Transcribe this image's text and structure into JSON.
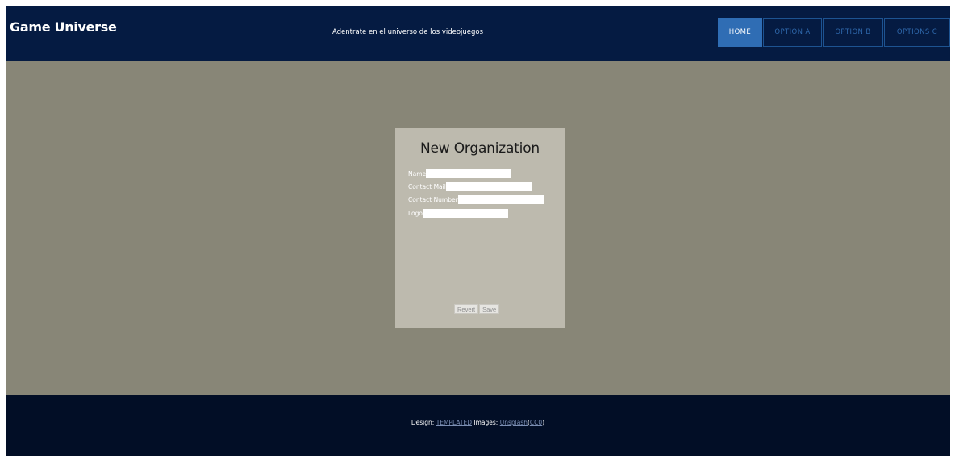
{
  "header": {
    "brand": "Game Universe",
    "tagline": "Adentrate en el universo de los videojuegos",
    "nav": [
      {
        "label": "HOME"
      },
      {
        "label": "OPTION A"
      },
      {
        "label": "OPTION B"
      },
      {
        "label": "OPTIONS C"
      }
    ]
  },
  "form": {
    "title": "New Organization",
    "fields": [
      {
        "label": "Name",
        "value": ""
      },
      {
        "label": "Contact Mail",
        "value": ""
      },
      {
        "label": "Contact Number",
        "value": ""
      },
      {
        "label": "Logo",
        "value": ""
      }
    ],
    "revert_label": "Revert",
    "save_label": "Save"
  },
  "footer": {
    "design_prefix": "Design:",
    "design_link": "TEMPLATED",
    "images_prefix": "Images:",
    "images_link": "Unsplash",
    "license_open": "(",
    "license_link": "CC0",
    "license_close": ")"
  },
  "colors": {
    "header_bg": "#051b42",
    "page_bg": "#888677",
    "card_bg": "#bdbaae",
    "footer_bg": "#020e26",
    "nav_active": "#2f6db4",
    "nav_text": "#2f69ad"
  }
}
